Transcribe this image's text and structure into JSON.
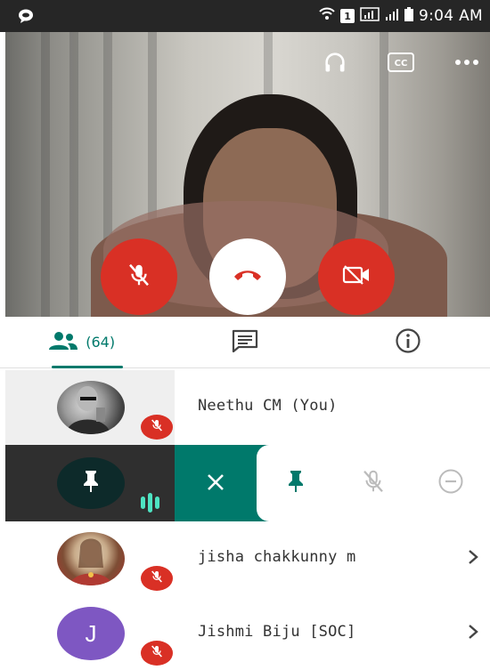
{
  "status_bar": {
    "sim_slot": "1",
    "time": "9:04 AM"
  },
  "video": {
    "toolbar": {
      "audio_icon": "headphones-icon",
      "captions_label": "CC",
      "more_icon": "more-horizontal-icon"
    },
    "controls": {
      "mic_icon": "mic-off-icon",
      "end_icon": "call-end-icon",
      "camera_icon": "videocam-off-icon"
    }
  },
  "tabs": {
    "people_count": "(64)",
    "chat_icon": "chat-icon",
    "info_icon": "info-icon"
  },
  "participants": [
    {
      "name": "Neethu CM (You)",
      "avatar": "photo",
      "muted": true
    },
    {
      "name": "",
      "avatar": "pin",
      "speaking": true
    },
    {
      "name": "jisha chakkunny m",
      "avatar": "photo",
      "muted": true
    },
    {
      "name": "Jishmi Biju [SOC]",
      "avatar_letter": "J",
      "muted": true
    }
  ],
  "colors": {
    "accent": "#00796b",
    "danger": "#d93025",
    "avatar_purple": "#7e57c2",
    "speaking_bars": "#4ee3c2"
  }
}
